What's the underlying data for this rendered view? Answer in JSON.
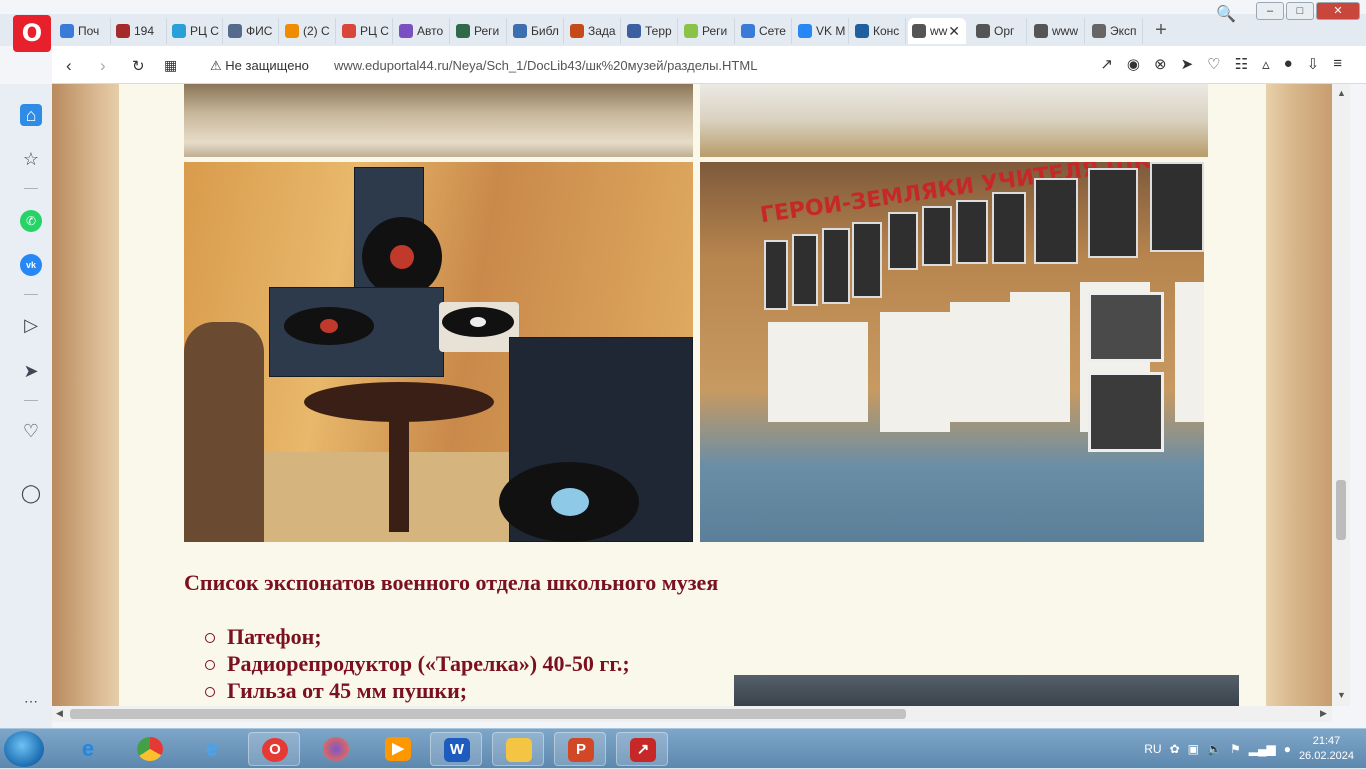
{
  "browser": {
    "tabs": [
      {
        "label": "Поч",
        "color": "#3b7bd8"
      },
      {
        "label": "194",
        "color": "#a52a2a"
      },
      {
        "label": "РЦ С",
        "color": "#2aa0d8"
      },
      {
        "label": "ФИС",
        "color": "#556b8e"
      },
      {
        "label": "(2) С",
        "color": "#f08c00"
      },
      {
        "label": "РЦ С",
        "color": "#d9463a"
      },
      {
        "label": "Авто",
        "color": "#7a4fbf"
      },
      {
        "label": "Реги",
        "color": "#2f6a4a"
      },
      {
        "label": "Библ",
        "color": "#3b6fb0"
      },
      {
        "label": "Зада",
        "color": "#c44a1a"
      },
      {
        "label": "Терр",
        "color": "#3b5fa0"
      },
      {
        "label": "Реги",
        "color": "#8bc34a"
      },
      {
        "label": "Сете",
        "color": "#3b7bd8"
      },
      {
        "label": "VK M",
        "color": "#2787f5"
      },
      {
        "label": "Конс",
        "color": "#1f5fa0"
      },
      {
        "label": "ww",
        "color": "#555555"
      },
      {
        "label": "Орг",
        "color": "#555555"
      },
      {
        "label": "www",
        "color": "#555555"
      },
      {
        "label": "Эксп",
        "color": "#666666"
      }
    ],
    "new_tab": "+",
    "security_warning": "Не защищено",
    "url": "www.eduportal44.ru/Neya/Sch_1/DocLib43/шк%20музей/разделы.HTML"
  },
  "page": {
    "heading": "Список экспонатов военного отдела школьного музея",
    "exhibits": [
      "Патефон;",
      "Радиорепродуктор («Тарелка») 40-50 гг.;",
      "Гильза от 45 мм пушки;"
    ],
    "wall_banner": "ГЕРОИ-ЗЕМЛЯКИ  УЧИТЕЛЯ ШКОЛЫ"
  },
  "taskbar": {
    "language": "RU",
    "time": "21:47",
    "date": "26.02.2024"
  }
}
